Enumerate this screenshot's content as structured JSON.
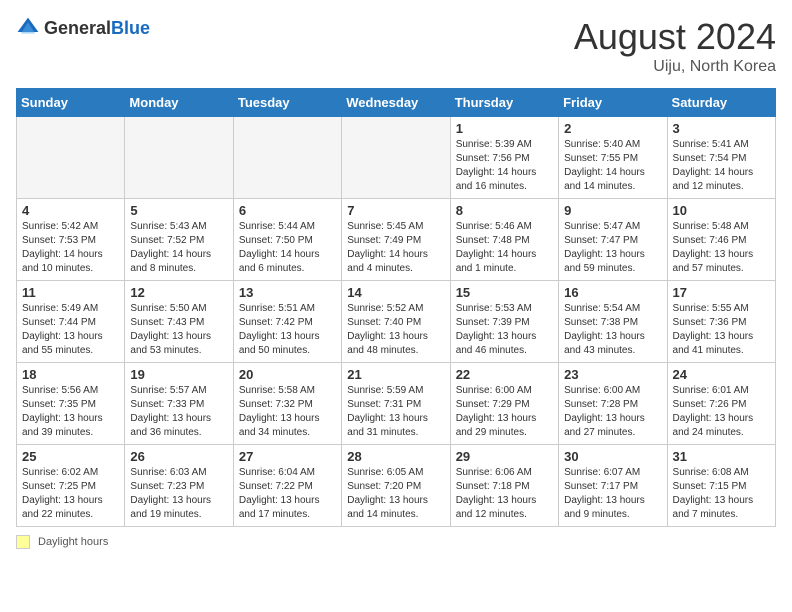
{
  "logo": {
    "general": "General",
    "blue": "Blue"
  },
  "title": "August 2024",
  "location": "Uiju, North Korea",
  "days_of_week": [
    "Sunday",
    "Monday",
    "Tuesday",
    "Wednesday",
    "Thursday",
    "Friday",
    "Saturday"
  ],
  "footer": {
    "label": "Daylight hours"
  },
  "weeks": [
    [
      {
        "day": "",
        "info": ""
      },
      {
        "day": "",
        "info": ""
      },
      {
        "day": "",
        "info": ""
      },
      {
        "day": "",
        "info": ""
      },
      {
        "day": "1",
        "info": "Sunrise: 5:39 AM\nSunset: 7:56 PM\nDaylight: 14 hours\nand 16 minutes."
      },
      {
        "day": "2",
        "info": "Sunrise: 5:40 AM\nSunset: 7:55 PM\nDaylight: 14 hours\nand 14 minutes."
      },
      {
        "day": "3",
        "info": "Sunrise: 5:41 AM\nSunset: 7:54 PM\nDaylight: 14 hours\nand 12 minutes."
      }
    ],
    [
      {
        "day": "4",
        "info": "Sunrise: 5:42 AM\nSunset: 7:53 PM\nDaylight: 14 hours\nand 10 minutes."
      },
      {
        "day": "5",
        "info": "Sunrise: 5:43 AM\nSunset: 7:52 PM\nDaylight: 14 hours\nand 8 minutes."
      },
      {
        "day": "6",
        "info": "Sunrise: 5:44 AM\nSunset: 7:50 PM\nDaylight: 14 hours\nand 6 minutes."
      },
      {
        "day": "7",
        "info": "Sunrise: 5:45 AM\nSunset: 7:49 PM\nDaylight: 14 hours\nand 4 minutes."
      },
      {
        "day": "8",
        "info": "Sunrise: 5:46 AM\nSunset: 7:48 PM\nDaylight: 14 hours\nand 1 minute."
      },
      {
        "day": "9",
        "info": "Sunrise: 5:47 AM\nSunset: 7:47 PM\nDaylight: 13 hours\nand 59 minutes."
      },
      {
        "day": "10",
        "info": "Sunrise: 5:48 AM\nSunset: 7:46 PM\nDaylight: 13 hours\nand 57 minutes."
      }
    ],
    [
      {
        "day": "11",
        "info": "Sunrise: 5:49 AM\nSunset: 7:44 PM\nDaylight: 13 hours\nand 55 minutes."
      },
      {
        "day": "12",
        "info": "Sunrise: 5:50 AM\nSunset: 7:43 PM\nDaylight: 13 hours\nand 53 minutes."
      },
      {
        "day": "13",
        "info": "Sunrise: 5:51 AM\nSunset: 7:42 PM\nDaylight: 13 hours\nand 50 minutes."
      },
      {
        "day": "14",
        "info": "Sunrise: 5:52 AM\nSunset: 7:40 PM\nDaylight: 13 hours\nand 48 minutes."
      },
      {
        "day": "15",
        "info": "Sunrise: 5:53 AM\nSunset: 7:39 PM\nDaylight: 13 hours\nand 46 minutes."
      },
      {
        "day": "16",
        "info": "Sunrise: 5:54 AM\nSunset: 7:38 PM\nDaylight: 13 hours\nand 43 minutes."
      },
      {
        "day": "17",
        "info": "Sunrise: 5:55 AM\nSunset: 7:36 PM\nDaylight: 13 hours\nand 41 minutes."
      }
    ],
    [
      {
        "day": "18",
        "info": "Sunrise: 5:56 AM\nSunset: 7:35 PM\nDaylight: 13 hours\nand 39 minutes."
      },
      {
        "day": "19",
        "info": "Sunrise: 5:57 AM\nSunset: 7:33 PM\nDaylight: 13 hours\nand 36 minutes."
      },
      {
        "day": "20",
        "info": "Sunrise: 5:58 AM\nSunset: 7:32 PM\nDaylight: 13 hours\nand 34 minutes."
      },
      {
        "day": "21",
        "info": "Sunrise: 5:59 AM\nSunset: 7:31 PM\nDaylight: 13 hours\nand 31 minutes."
      },
      {
        "day": "22",
        "info": "Sunrise: 6:00 AM\nSunset: 7:29 PM\nDaylight: 13 hours\nand 29 minutes."
      },
      {
        "day": "23",
        "info": "Sunrise: 6:00 AM\nSunset: 7:28 PM\nDaylight: 13 hours\nand 27 minutes."
      },
      {
        "day": "24",
        "info": "Sunrise: 6:01 AM\nSunset: 7:26 PM\nDaylight: 13 hours\nand 24 minutes."
      }
    ],
    [
      {
        "day": "25",
        "info": "Sunrise: 6:02 AM\nSunset: 7:25 PM\nDaylight: 13 hours\nand 22 minutes."
      },
      {
        "day": "26",
        "info": "Sunrise: 6:03 AM\nSunset: 7:23 PM\nDaylight: 13 hours\nand 19 minutes."
      },
      {
        "day": "27",
        "info": "Sunrise: 6:04 AM\nSunset: 7:22 PM\nDaylight: 13 hours\nand 17 minutes."
      },
      {
        "day": "28",
        "info": "Sunrise: 6:05 AM\nSunset: 7:20 PM\nDaylight: 13 hours\nand 14 minutes."
      },
      {
        "day": "29",
        "info": "Sunrise: 6:06 AM\nSunset: 7:18 PM\nDaylight: 13 hours\nand 12 minutes."
      },
      {
        "day": "30",
        "info": "Sunrise: 6:07 AM\nSunset: 7:17 PM\nDaylight: 13 hours\nand 9 minutes."
      },
      {
        "day": "31",
        "info": "Sunrise: 6:08 AM\nSunset: 7:15 PM\nDaylight: 13 hours\nand 7 minutes."
      }
    ]
  ]
}
